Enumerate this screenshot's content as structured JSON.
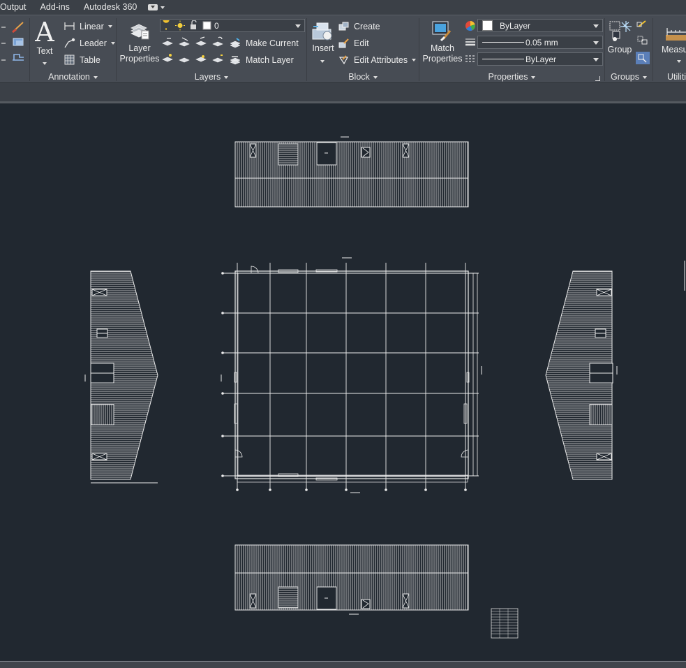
{
  "menu": {
    "tabs": [
      "Output",
      "Add-ins",
      "Autodesk 360"
    ]
  },
  "ribbon": {
    "annotation": {
      "title": "Annotation",
      "text_label": "Text",
      "linear_label": "Linear",
      "leader_label": "Leader",
      "table_label": "Table"
    },
    "layers": {
      "title": "Layers",
      "layer_properties_label": "Layer\nProperties",
      "current_layer": "0",
      "make_current_label": "Make Current",
      "match_layer_label": "Match Layer"
    },
    "block": {
      "title": "Block",
      "insert_label": "Insert",
      "create_label": "Create",
      "edit_label": "Edit",
      "edit_attributes_label": "Edit Attributes"
    },
    "properties": {
      "title": "Properties",
      "match_properties_label": "Match\nProperties",
      "color_value": "ByLayer",
      "lineweight_value": "0.05 mm",
      "linetype_value": "ByLayer"
    },
    "groups": {
      "title": "Groups",
      "group_label": "Group"
    },
    "utilities": {
      "title": "Utiliti",
      "measure_label": "Measu"
    }
  },
  "colors": {
    "canvas": "#212830",
    "ribbon": "#474c54",
    "tabbar": "#3b4047",
    "drawing_line": "#e8e8e8",
    "highlight": "#5b7fb8"
  }
}
